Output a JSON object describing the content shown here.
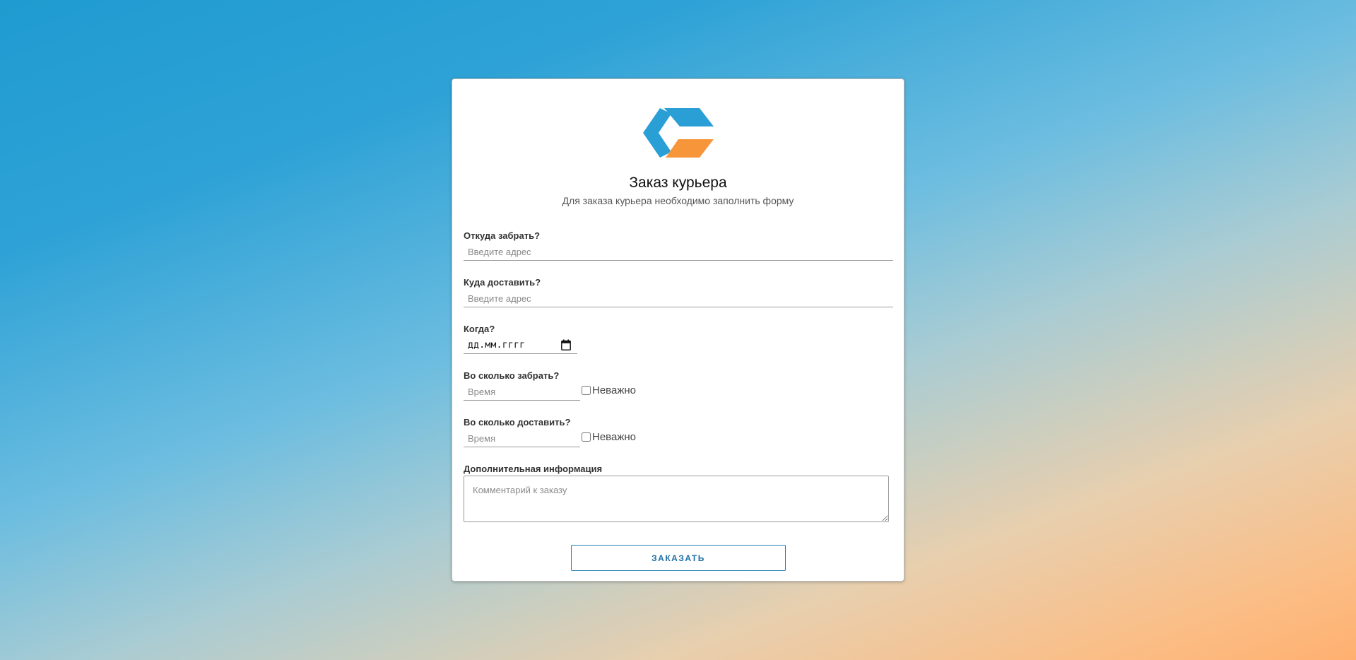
{
  "form": {
    "title": "Заказ курьера",
    "subtitle": "Для заказа курьера необходимо заполнить форму",
    "logo_icon": "cube-logo-icon",
    "colors": {
      "accent": "#2a9fd6",
      "secondary": "#f7953b",
      "button_border": "#1f7fb5"
    },
    "from": {
      "label": "Откуда забрать?",
      "placeholder": "Введите адрес"
    },
    "to": {
      "label": "Куда доставить?",
      "placeholder": "Введите адрес"
    },
    "when": {
      "label": "Когда?",
      "value": "дд.мм.гггг",
      "icon": "calendar-icon"
    },
    "pickup_time": {
      "label": "Во сколько забрать?",
      "placeholder": "Время",
      "checkbox_label": "Неважно"
    },
    "delivery_time": {
      "label": "Во сколько доставить?",
      "placeholder": "Время",
      "checkbox_label": "Неважно"
    },
    "additional": {
      "label": "Дополнительная информация",
      "placeholder": "Комментарий к заказу"
    },
    "submit_label": "ЗАКАЗАТЬ"
  }
}
